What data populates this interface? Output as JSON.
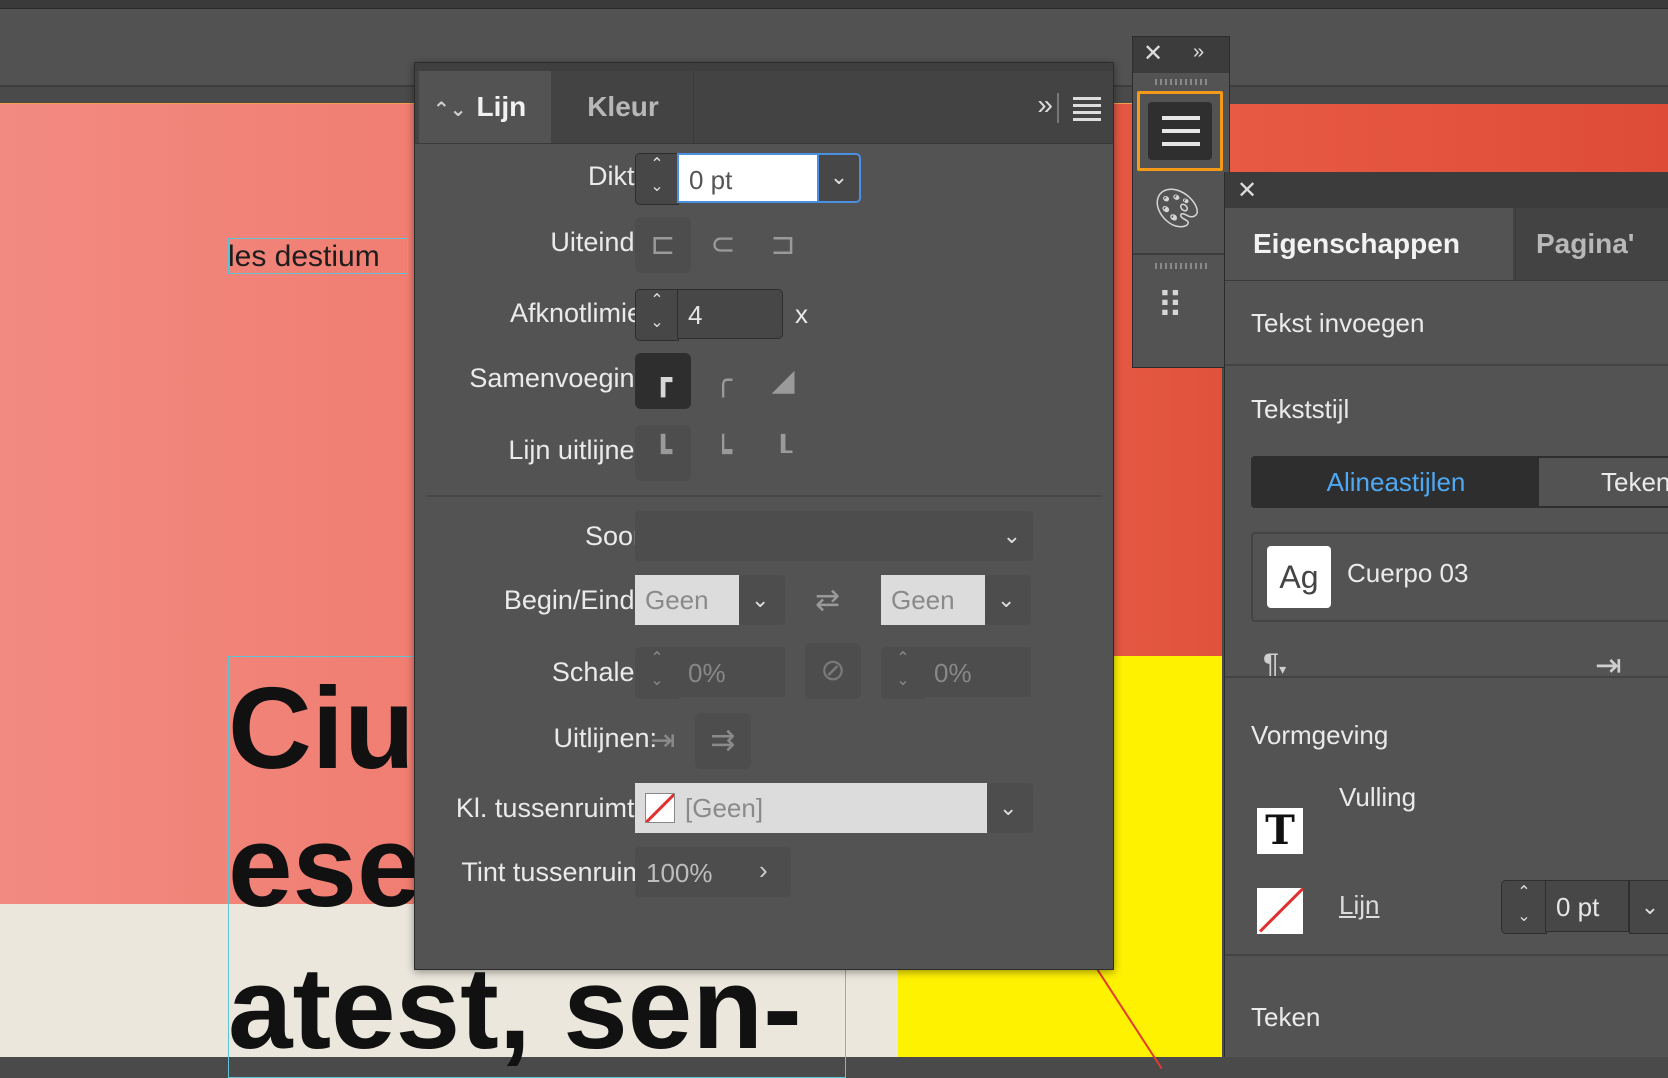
{
  "canvas": {
    "small_text": "les destium",
    "big_lines": [
      "Ciu",
      "ese",
      "atest, sen-"
    ]
  },
  "stroke_panel": {
    "tabs": [
      {
        "label": "Lijn",
        "updown": "⌃⌄"
      },
      {
        "label": "Kleur"
      }
    ],
    "expand_icon": "»",
    "fields": {
      "dikte": {
        "label": "Dikte:",
        "value": "0 pt"
      },
      "uiteinde": {
        "label": "Uiteinde:"
      },
      "afknotlimiet": {
        "label": "Afknotlimiet:",
        "value": "4",
        "suffix": "x"
      },
      "samenvoeging": {
        "label": "Samenvoeging:"
      },
      "lijn_uitlijnen": {
        "label": "Lijn uitlijnen:"
      },
      "soort": {
        "label": "Soort:",
        "value": ""
      },
      "begin_einde": {
        "label": "Begin/Einde:",
        "begin": "Geen",
        "einde": "Geen"
      },
      "schalen": {
        "label": "Schalen:",
        "value1": "0%",
        "value2": "0%"
      },
      "uitlijnen": {
        "label": "Uitlijnen:"
      },
      "kl_tussenruimte": {
        "label": "Kl. tussenruimte:",
        "value": "[Geen]"
      },
      "tint_tussenruimte": {
        "label": "Tint tussenruimte:",
        "value": "100%"
      }
    }
  },
  "tool_strip": {
    "close": "✕",
    "expand": "»"
  },
  "properties_panel": {
    "close": "✕",
    "tabs": [
      "Eigenschappen",
      "Pagina'"
    ],
    "insert_text": "Tekst invoegen",
    "text_style_heading": "Tekststijl",
    "segments": [
      "Alineastijlen",
      "Teken"
    ],
    "style_thumb": "Ag",
    "style_name": "Cuerpo 03",
    "appearance_heading": "Vormgeving",
    "fill_label": "Vulling",
    "stroke_label": "Lijn",
    "stroke_value": "0 pt",
    "char_heading": "Teken"
  },
  "colors": {
    "accent_highlight": "#f39a18",
    "segment_active_text": "#4ea9f5",
    "doc_red": "#f07a6c",
    "doc_yellow": "#fff200"
  }
}
